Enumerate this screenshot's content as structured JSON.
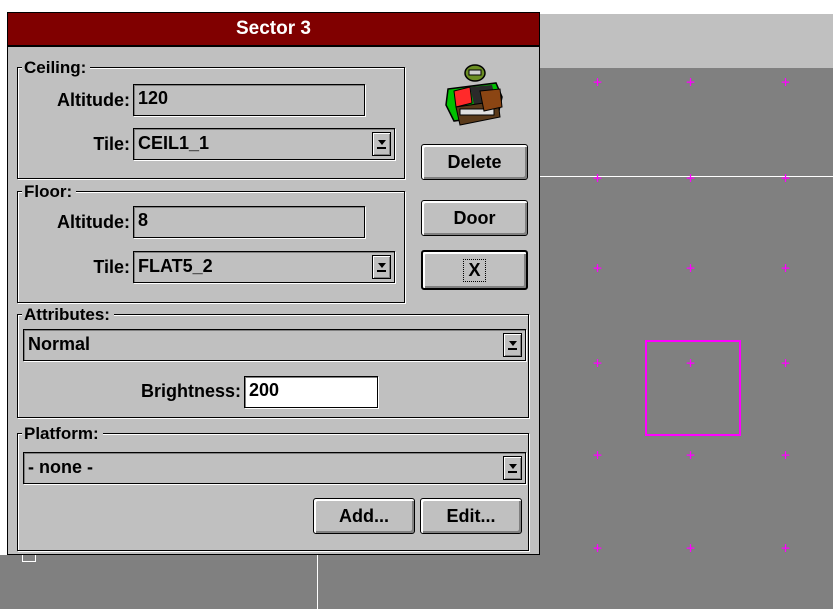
{
  "dialog": {
    "title": "Sector 3",
    "ceiling": {
      "legend": "Ceiling:",
      "altitude_label": "Altitude:",
      "altitude_value": "120",
      "tile_label": "Tile:",
      "tile_value": "CEIL1_1"
    },
    "floor": {
      "legend": "Floor:",
      "altitude_label": "Altitude:",
      "altitude_value": "8",
      "tile_label": "Tile:",
      "tile_value": "FLAT5_2"
    },
    "attributes": {
      "legend": "Attributes:",
      "value": "Normal",
      "brightness_label": "Brightness:",
      "brightness_value": "200"
    },
    "platform": {
      "legend": "Platform:",
      "value": "- none -",
      "add_label": "Add...",
      "edit_label": "Edit..."
    },
    "buttons": {
      "delete_label": "Delete",
      "door_label": "Door",
      "close_label": "X"
    },
    "icon": "doom-marine-icon"
  },
  "colors": {
    "title_bar": "#800000",
    "dialog_face": "#c0c0c0",
    "map_background": "#808080",
    "grid_marker": "#ff00ff",
    "selection": "#ff00ff",
    "map_line": "#ffffff"
  }
}
